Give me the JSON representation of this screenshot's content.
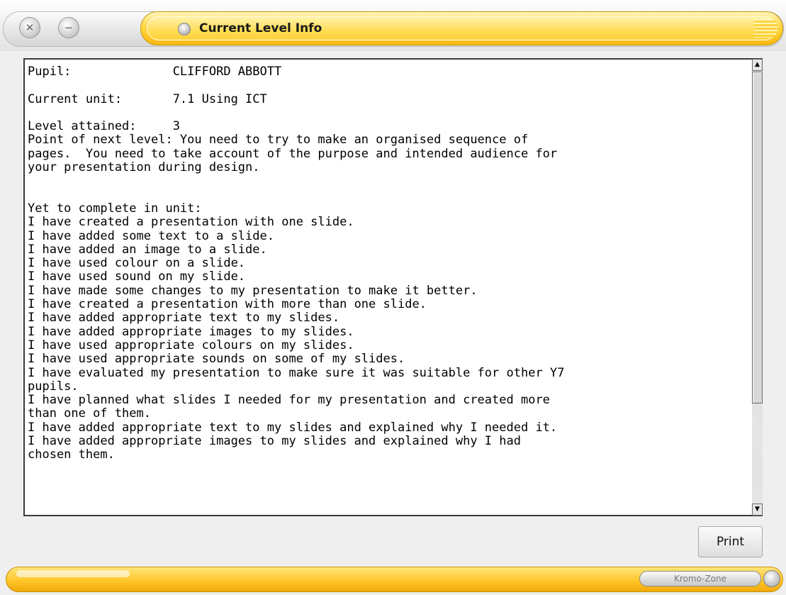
{
  "window": {
    "title": "Current Level Info",
    "close_glyph": "✕",
    "minimize_glyph": "−",
    "title_icon_glyph": "›"
  },
  "content": {
    "lines": [
      "Pupil:              CLIFFORD ABBOTT",
      "",
      "Current unit:       7.1 Using ICT",
      "",
      "Level attained:     3",
      "Point of next level: You need to try to make an organised sequence of",
      "pages.  You need to take account of the purpose and intended audience for",
      "your presentation during design.",
      "",
      "",
      "Yet to complete in unit:",
      "I have created a presentation with one slide.",
      "I have added some text to a slide.",
      "I have added an image to a slide.",
      "I have used colour on a slide.",
      "I have used sound on my slide.",
      "I have made some changes to my presentation to make it better.",
      "I have created a presentation with more than one slide.",
      "I have added appropriate text to my slides.",
      "I have added appropriate images to my slides.",
      "I have used appropriate colours on my slides.",
      "I have used appropriate sounds on some of my slides.",
      "I have evaluated my presentation to make sure it was suitable for other Y7",
      "pupils.",
      "I have planned what slides I needed for my presentation and created more",
      "than one of them.",
      "I have added appropriate text to my slides and explained why I needed it.",
      "I have added appropriate images to my slides and explained why I had",
      "chosen them."
    ]
  },
  "scrollbar": {
    "up_glyph": "▲",
    "down_glyph": "▼"
  },
  "buttons": {
    "print_label": "Print"
  },
  "footer": {
    "brand": "Kromo-Zone"
  },
  "colors": {
    "accent": "#ffd13a",
    "frame": "#efefef"
  }
}
